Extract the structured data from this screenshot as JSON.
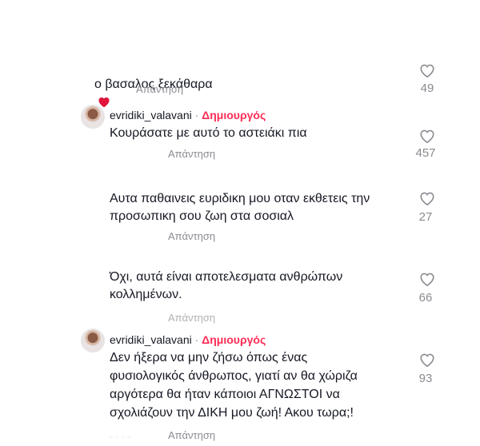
{
  "comments": [
    {
      "username": "",
      "text": "ο βασαλος ξεκάθαρα",
      "reply_label": "Απάντηση",
      "like_count": "49",
      "has_emoji_heart": true
    },
    {
      "username": "evridiki_valavani",
      "separator": "·",
      "creator_badge": "Δημιουργός",
      "text": "Κουράσατε με αυτό το αστειάκι πια",
      "reply_label": "Απάντηση",
      "like_count": "457"
    },
    {
      "username": "",
      "text": "Αυτα παθαινεις ευριδικη μου οταν εκθετεις την\nπροσωπικη σου ζωη στα σοσιαλ",
      "reply_label": "Απάντηση",
      "like_count": "27"
    },
    {
      "username": "",
      "text": "Όχι, αυτά είναι αποτελεσματα ανθρώπων\nκολλημένων.",
      "reply_label": "Απάντηση",
      "like_count": "66"
    },
    {
      "username": "evridiki_valavani",
      "separator": "·",
      "creator_badge": "Δημιουργός",
      "text": "Δεν ήξερα να μην ζήσω όπως ένας\nφυσιολογικός άνθρωπος, γιατί αν θα χώριζα\nαργότερα θα ήταν κάποιοι ΑΓΝΩΣΤΟΙ να\nσχολιάζουν την ΔΙΚΗ μου ζωή! Ακου τωρα;!",
      "reply_label": "Απάντηση",
      "like_count": "93"
    }
  ],
  "colors": {
    "creator": "#fe2c55",
    "muted": "#8a8b91",
    "emoji_heart": "#e0143c"
  },
  "icons": {
    "like": "heart-outline-icon",
    "emoji": "red-heart-emoji-icon"
  }
}
